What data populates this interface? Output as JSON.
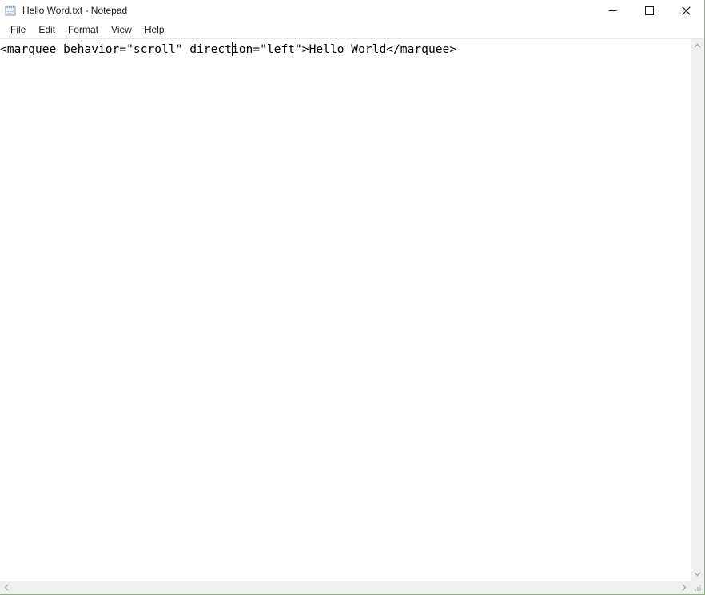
{
  "window": {
    "title": "Hello Word.txt - Notepad",
    "app_icon": "notepad-icon",
    "border_color": "#8fae7a",
    "background": "#ffffff"
  },
  "titlebar": {
    "minimize_label": "Minimize",
    "maximize_label": "Maximize",
    "close_label": "Close",
    "minimize_icon": "minimize-icon",
    "maximize_icon": "maximize-icon",
    "close_icon": "close-icon"
  },
  "menubar": {
    "items": [
      {
        "label": "File"
      },
      {
        "label": "Edit"
      },
      {
        "label": "Format"
      },
      {
        "label": "View"
      },
      {
        "label": "Help"
      }
    ]
  },
  "editor": {
    "content": "<marquee behavior=\"scroll\" direction=\"left\">Hello World</marquee>",
    "caret_visible": true,
    "caret_after_text": "<marquee behavior=\"scroll\" direct",
    "text_color": "#000000",
    "background": "#ffffff"
  },
  "scrollbars": {
    "vertical": {
      "up_icon": "chevron-up-icon",
      "down_icon": "chevron-down-icon",
      "track_color": "#f0f0f0",
      "arrow_color": "#a3a3a3"
    },
    "horizontal": {
      "left_icon": "chevron-left-icon",
      "right_icon": "chevron-right-icon",
      "track_color": "#f0f0f0",
      "arrow_color": "#a3a3a3"
    },
    "resize_grip_icon": "resize-grip-icon"
  }
}
